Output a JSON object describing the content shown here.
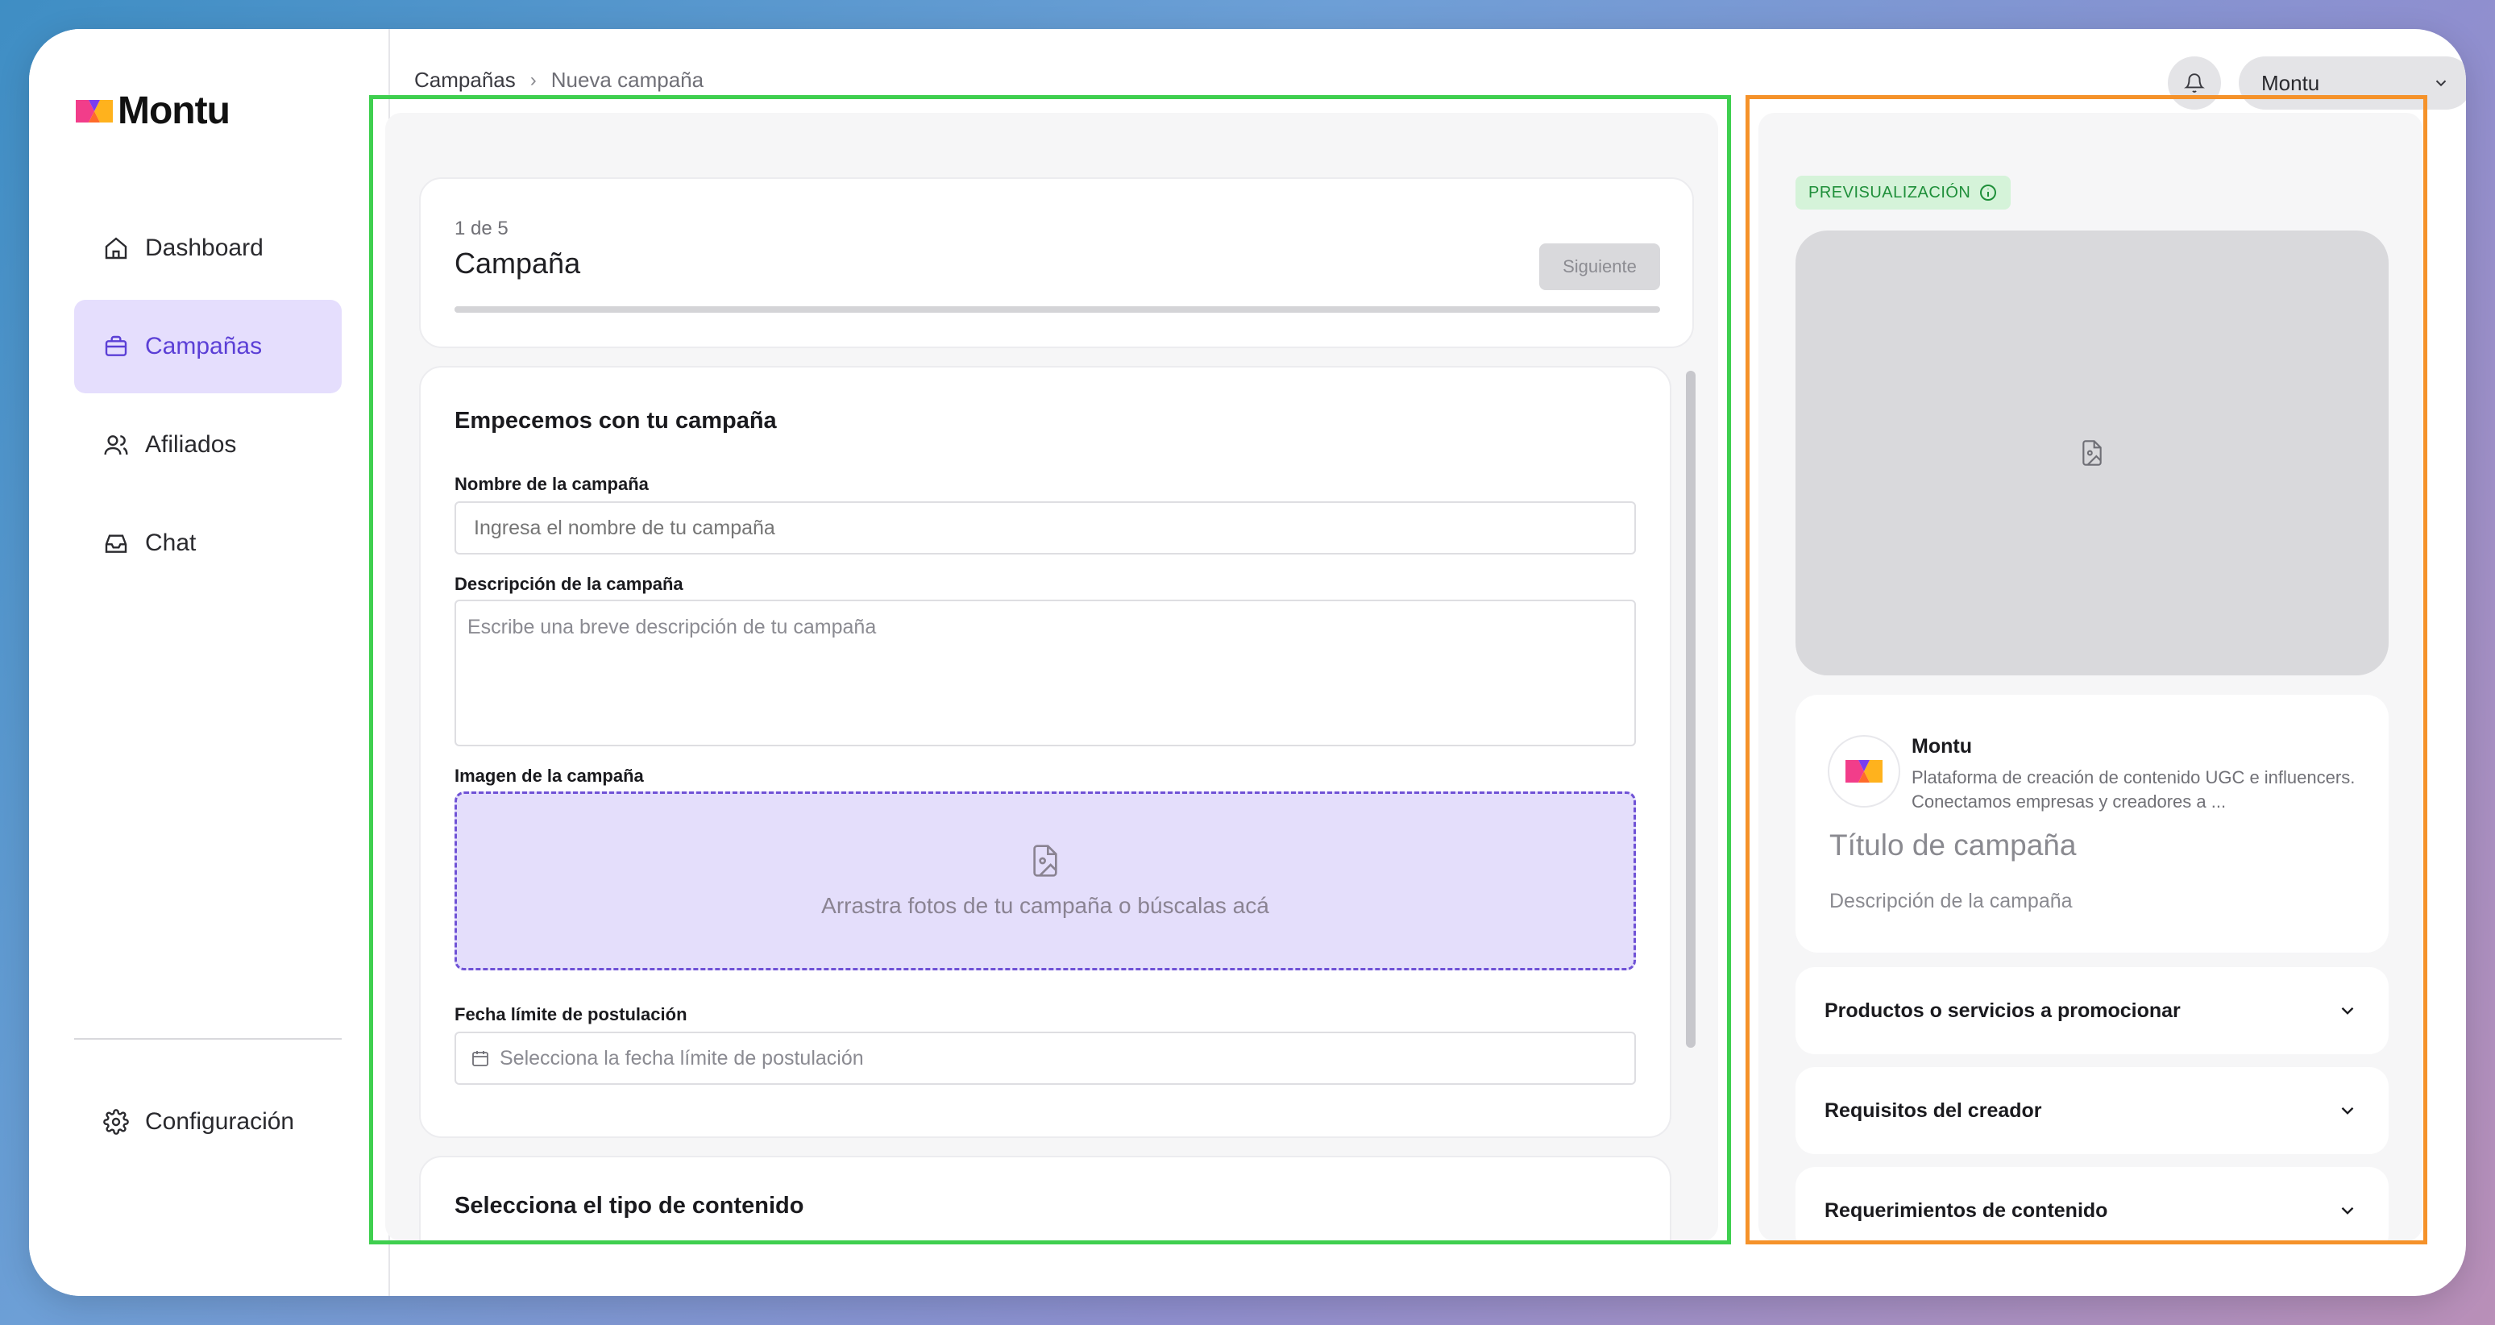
{
  "app": {
    "name": "Montu"
  },
  "sidebar": {
    "items": [
      {
        "label": "Dashboard",
        "icon": "home-icon"
      },
      {
        "label": "Campañas",
        "icon": "briefcase-icon",
        "active": true
      },
      {
        "label": "Afiliados",
        "icon": "users-icon"
      },
      {
        "label": "Chat",
        "icon": "inbox-icon"
      }
    ],
    "config": {
      "label": "Configuración",
      "icon": "gear-icon"
    }
  },
  "header": {
    "breadcrumb": [
      "Campañas",
      "Nueva campaña"
    ],
    "user": "Montu"
  },
  "step": {
    "count": "1 de 5",
    "title": "Campaña",
    "next_label": "Siguiente"
  },
  "form": {
    "section_title": "Empecemos con tu campaña",
    "name_label": "Nombre de la campaña",
    "name_placeholder": "Ingresa el nombre de tu campaña",
    "description_label": "Descripción de la campaña",
    "description_placeholder": "Escribe una breve descripción de tu campaña",
    "image_label": "Imagen de la campaña",
    "dropzone_text": "Arrastra fotos de tu campaña o búscalas acá",
    "deadline_label": "Fecha límite de postulación",
    "deadline_placeholder": "Selecciona la fecha límite de postulación"
  },
  "content_section": {
    "title": "Selecciona el tipo de contenido"
  },
  "preview": {
    "badge": "PREVISUALIZACIÓN",
    "brand_name": "Montu",
    "brand_description": "Plataforma de creación de contenido UGC e influencers. Conectamos empresas y creadores a ...",
    "campaign_title": "Título de campaña",
    "campaign_description": "Descripción de la campaña",
    "accordions": [
      {
        "label": "Productos o servicios a promocionar"
      },
      {
        "label": "Requisitos del creador"
      },
      {
        "label": "Requerimientos de contenido"
      }
    ]
  },
  "colors": {
    "accent": "#5b3fd6",
    "accent_light": "#e5defd",
    "preview_badge_bg": "#d5f3d9",
    "preview_badge_text": "#1f8f3a",
    "annotation_green": "#3fcf4f",
    "annotation_orange": "#f5922a"
  }
}
